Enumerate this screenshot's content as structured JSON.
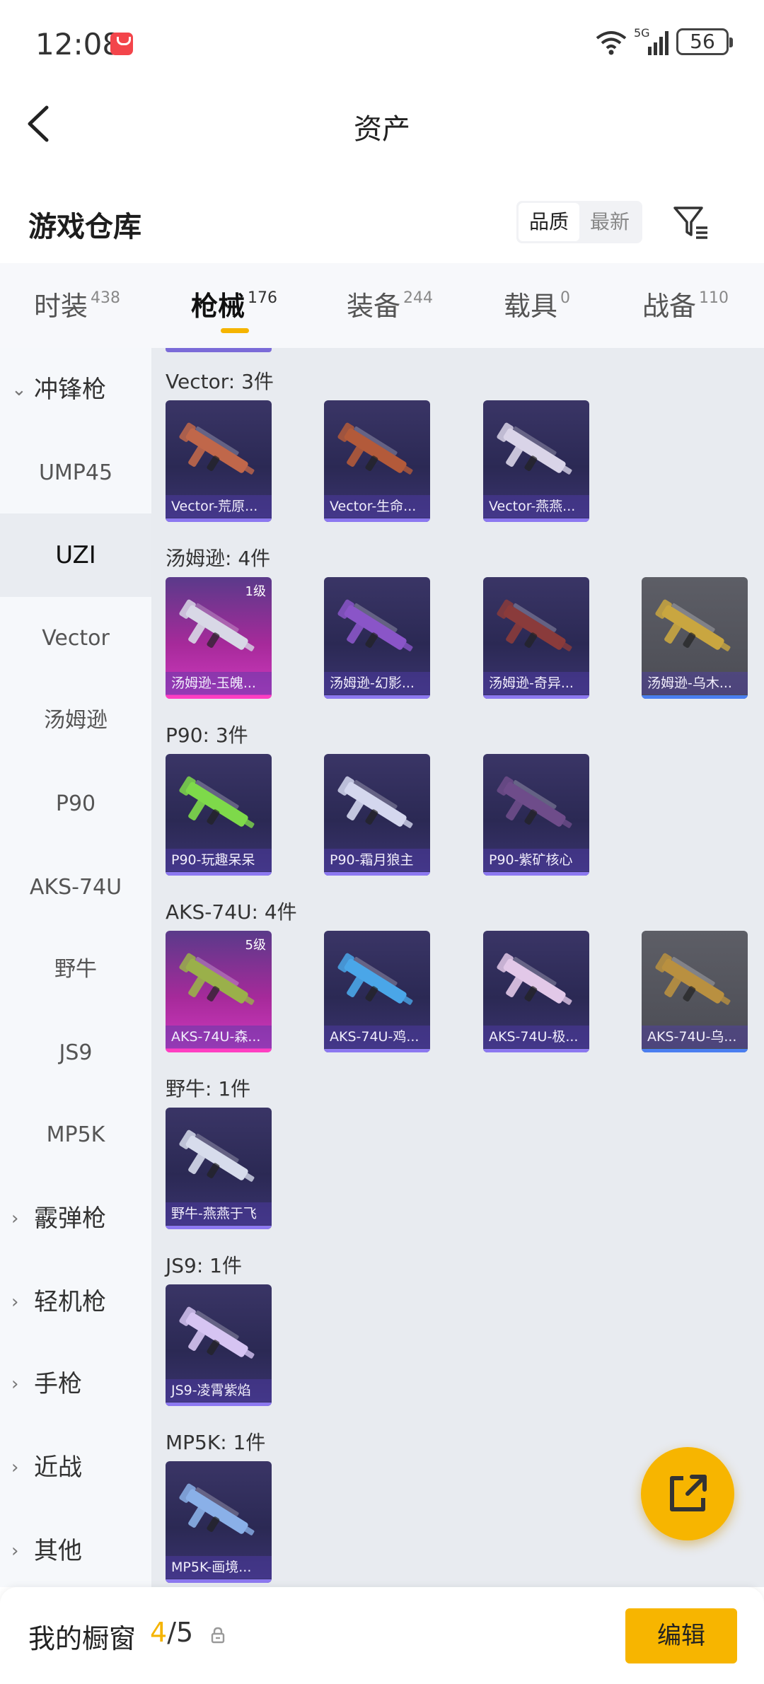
{
  "status": {
    "time": "12:08",
    "battery": "56",
    "network": "5G"
  },
  "header": {
    "title": "资产"
  },
  "warehouse": {
    "title": "游戏仓库",
    "sort_options": [
      "品质",
      "最新"
    ],
    "active_sort": "品质"
  },
  "tabs": [
    {
      "label": "时装",
      "count": "438"
    },
    {
      "label": "枪械",
      "count": "176"
    },
    {
      "label": "装备",
      "count": "244"
    },
    {
      "label": "载具",
      "count": "0"
    },
    {
      "label": "战备",
      "count": "110"
    }
  ],
  "active_tab": "枪械",
  "sidebar": {
    "items": [
      {
        "label": "冲锋枪",
        "type": "group",
        "expanded": true
      },
      {
        "label": "UMP45",
        "type": "item"
      },
      {
        "label": "UZI",
        "type": "item",
        "active": true
      },
      {
        "label": "Vector",
        "type": "item"
      },
      {
        "label": "汤姆逊",
        "type": "item"
      },
      {
        "label": "P90",
        "type": "item"
      },
      {
        "label": "AKS-74U",
        "type": "item"
      },
      {
        "label": "野牛",
        "type": "item"
      },
      {
        "label": "JS9",
        "type": "item"
      },
      {
        "label": "MP5K",
        "type": "item"
      },
      {
        "label": "霰弹枪",
        "type": "group"
      },
      {
        "label": "轻机枪",
        "type": "group"
      },
      {
        "label": "手枪",
        "type": "group"
      },
      {
        "label": "近战",
        "type": "group"
      },
      {
        "label": "其他",
        "type": "group"
      }
    ]
  },
  "groups": [
    {
      "title": "Vector: 3件",
      "items": [
        {
          "label": "Vector-荒原...",
          "rarity": "purple",
          "gun_color": "#c0674a"
        },
        {
          "label": "Vector-生命...",
          "rarity": "purple",
          "gun_color": "#b35a3a"
        },
        {
          "label": "Vector-燕燕...",
          "rarity": "purple",
          "gun_color": "#d9d4e8"
        }
      ]
    },
    {
      "title": "汤姆逊: 4件",
      "items": [
        {
          "label": "汤姆逊-玉魄...",
          "rarity": "pink",
          "level": "1级",
          "gun_color": "#d8d8e6"
        },
        {
          "label": "汤姆逊-幻影...",
          "rarity": "purple",
          "gun_color": "#8a55c8"
        },
        {
          "label": "汤姆逊-奇异...",
          "rarity": "purple",
          "gun_color": "#8a3b3b"
        },
        {
          "label": "汤姆逊-乌木...",
          "rarity": "grey",
          "gun_color": "#c9a640"
        }
      ]
    },
    {
      "title": "P90: 3件",
      "items": [
        {
          "label": "P90-玩趣呆呆",
          "rarity": "purple",
          "gun_color": "#7ed94a"
        },
        {
          "label": "P90-霜月狼主",
          "rarity": "purple",
          "gun_color": "#d4d7ee"
        },
        {
          "label": "P90-紫矿核心",
          "rarity": "purple",
          "gun_color": "#6e4c8a"
        }
      ]
    },
    {
      "title": "AKS-74U: 4件",
      "items": [
        {
          "label": "AKS-74U-森...",
          "rarity": "pink",
          "level": "5级",
          "gun_color": "#9ab04a"
        },
        {
          "label": "AKS-74U-鸡...",
          "rarity": "purple",
          "gun_color": "#4aa6e8"
        },
        {
          "label": "AKS-74U-极...",
          "rarity": "purple",
          "gun_color": "#e2c8e8"
        },
        {
          "label": "AKS-74U-乌...",
          "rarity": "grey",
          "gun_color": "#b99040"
        }
      ]
    },
    {
      "title": "野牛: 1件",
      "items": [
        {
          "label": "野牛-燕燕于飞",
          "rarity": "purple",
          "gun_color": "#d7dcec"
        }
      ]
    },
    {
      "title": "JS9: 1件",
      "items": [
        {
          "label": "JS9-凌霄紫焰",
          "rarity": "purple",
          "gun_color": "#d6c4f2"
        }
      ]
    },
    {
      "title": "MP5K: 1件",
      "items": [
        {
          "label": "MP5K-画境...",
          "rarity": "purple",
          "gun_color": "#8ab0e8"
        }
      ]
    }
  ],
  "showcase": {
    "label": "我的橱窗",
    "current": "4",
    "total": "/5"
  },
  "edit_label": "编辑",
  "colors": {
    "accent": "#f7b500",
    "purple_card": "#2b2954",
    "pink_card": "#c43ab6",
    "grey_card": "#4b4c54"
  }
}
